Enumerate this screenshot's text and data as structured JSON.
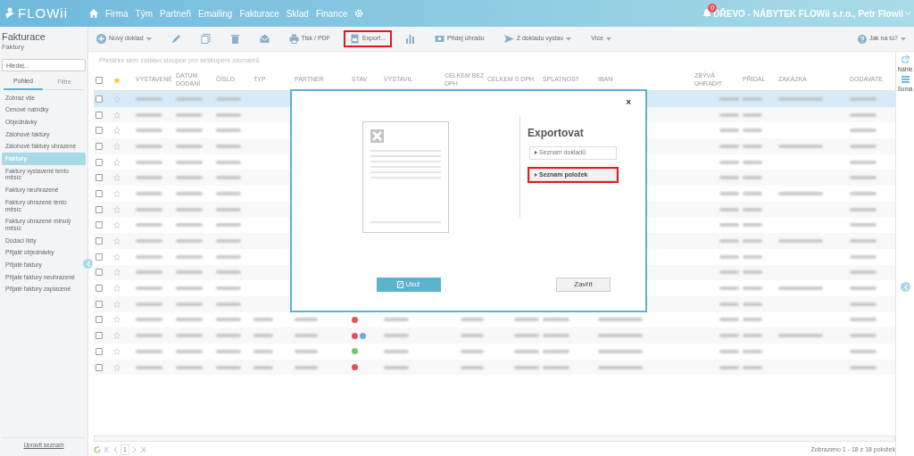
{
  "navbar": {
    "logo": "FLOWii",
    "items": [
      "Firma",
      "Tým",
      "Partneři",
      "Emailing",
      "Fakturace",
      "Sklad",
      "Finance"
    ],
    "notification_count": "0",
    "account": "DŘEVO - NÁBYTEK FLOWii s.r.o., Petr Flowii"
  },
  "page_header": {
    "title": "Fakturace",
    "subtitle": "Faktury"
  },
  "toolbar": {
    "items": [
      {
        "kind": "add",
        "label": "Nový doklad",
        "caret": true,
        "highlighted": false
      },
      {
        "kind": "edit",
        "caret": false,
        "highlighted": false
      },
      {
        "kind": "copy",
        "caret": false,
        "highlighted": false
      },
      {
        "kind": "delete",
        "caret": false,
        "highlighted": false
      },
      {
        "kind": "email",
        "caret": false,
        "highlighted": false
      },
      {
        "kind": "print",
        "label": "Tisk / PDF",
        "caret": false,
        "highlighted": false
      },
      {
        "kind": "export",
        "label": "Export...",
        "caret": false,
        "highlighted": true
      },
      {
        "kind": "chart",
        "caret": false,
        "highlighted": false
      },
      {
        "kind": "payment",
        "label": "Přidej úhradu",
        "caret": false,
        "highlighted": false
      },
      {
        "kind": "send",
        "label": "Z dokladu vystav",
        "caret": true,
        "highlighted": false
      },
      {
        "kind": "more",
        "label": "Více",
        "caret": true,
        "highlighted": false
      }
    ],
    "help": "Jak na to?"
  },
  "sidebar": {
    "search_placeholder": "Hledej...",
    "tabs": [
      {
        "label": "Pohled",
        "selected": true
      },
      {
        "label": "Filtre",
        "selected": false
      }
    ],
    "items": [
      {
        "label": "Zobraz vše",
        "selected": false
      },
      {
        "label": "Cenové nabídky",
        "selected": false
      },
      {
        "label": "Objednávky",
        "selected": false
      },
      {
        "label": "Zálohové faktury",
        "selected": false
      },
      {
        "label": "Zálohové faktury uhrazené",
        "selected": false
      },
      {
        "label": "Faktury",
        "selected": true
      },
      {
        "label": "Faktury vystavené tento měsíc",
        "selected": false
      },
      {
        "label": "Faktury neuhrazené",
        "selected": false
      },
      {
        "label": "Faktury uhrazené tento měsíc",
        "selected": false
      },
      {
        "label": "Faktury uhrazené minulý měsíc",
        "selected": false
      },
      {
        "label": "Dodací listy",
        "selected": false
      },
      {
        "label": "Přijaté objednávky",
        "selected": false
      },
      {
        "label": "Přijaté faktury",
        "selected": false
      },
      {
        "label": "Přijaté faktury neuhrazené",
        "selected": false
      },
      {
        "label": "Přijaté faktury zaplacené",
        "selected": false
      }
    ],
    "footer_link": "Upravit seznam"
  },
  "table": {
    "group_hint": "Přetáhni sem záhlaví sloupce pro seskupení záznamů",
    "columns": [
      "VYSTAVENÉ",
      "DATUM DODÁNÍ",
      "ČÍSLO",
      "TYP",
      "PARTNER",
      "STAV",
      "VYSTAVIL",
      "CELKEM BEZ DPH",
      "CELKEM S DPH",
      "SPLATNOST",
      "IBAN",
      "ZBÝVÁ UHRADIT",
      "PŘIDAL",
      "ZAKÁZKA",
      "DODAVATE"
    ],
    "all_checked": false,
    "rows": [
      {
        "selected": true,
        "checked": false
      },
      {
        "selected": false,
        "checked": false
      },
      {
        "selected": false,
        "checked": false
      },
      {
        "selected": false,
        "checked": false
      },
      {
        "selected": false,
        "checked": false
      },
      {
        "selected": false,
        "checked": false
      },
      {
        "selected": false,
        "checked": false
      },
      {
        "selected": false,
        "checked": false
      },
      {
        "selected": false,
        "checked": false
      },
      {
        "selected": false,
        "checked": false
      },
      {
        "selected": false,
        "checked": false
      },
      {
        "selected": false,
        "checked": false
      },
      {
        "selected": false,
        "checked": false
      },
      {
        "selected": false,
        "checked": false
      },
      {
        "selected": false,
        "checked": false,
        "statuses": [
          {
            "color": "#e8505b"
          }
        ]
      },
      {
        "selected": false,
        "checked": false,
        "statuses": [
          {
            "color": "#e8505b"
          },
          {
            "color": "#6fa8dc"
          }
        ]
      },
      {
        "selected": false,
        "checked": false,
        "statuses": [
          {
            "color": "#7dc462"
          }
        ]
      },
      {
        "selected": false,
        "checked": false,
        "statuses": [
          {
            "color": "#e8505b"
          }
        ]
      }
    ]
  },
  "right_panel": {
    "items": [
      "Náhle",
      "Sumá"
    ]
  },
  "pager": {
    "page": "1",
    "summary": "Zobrazeno 1 - 18 z 18 položek"
  },
  "dialog": {
    "title": "Exportovat",
    "options": [
      {
        "label": "Seznam dokladů",
        "selected": false,
        "highlighted": false
      },
      {
        "label": "Seznam položek",
        "selected": true,
        "highlighted": true
      }
    ],
    "save_button": "Ulož",
    "close_button": "Zavřít",
    "close_icon": "×"
  }
}
